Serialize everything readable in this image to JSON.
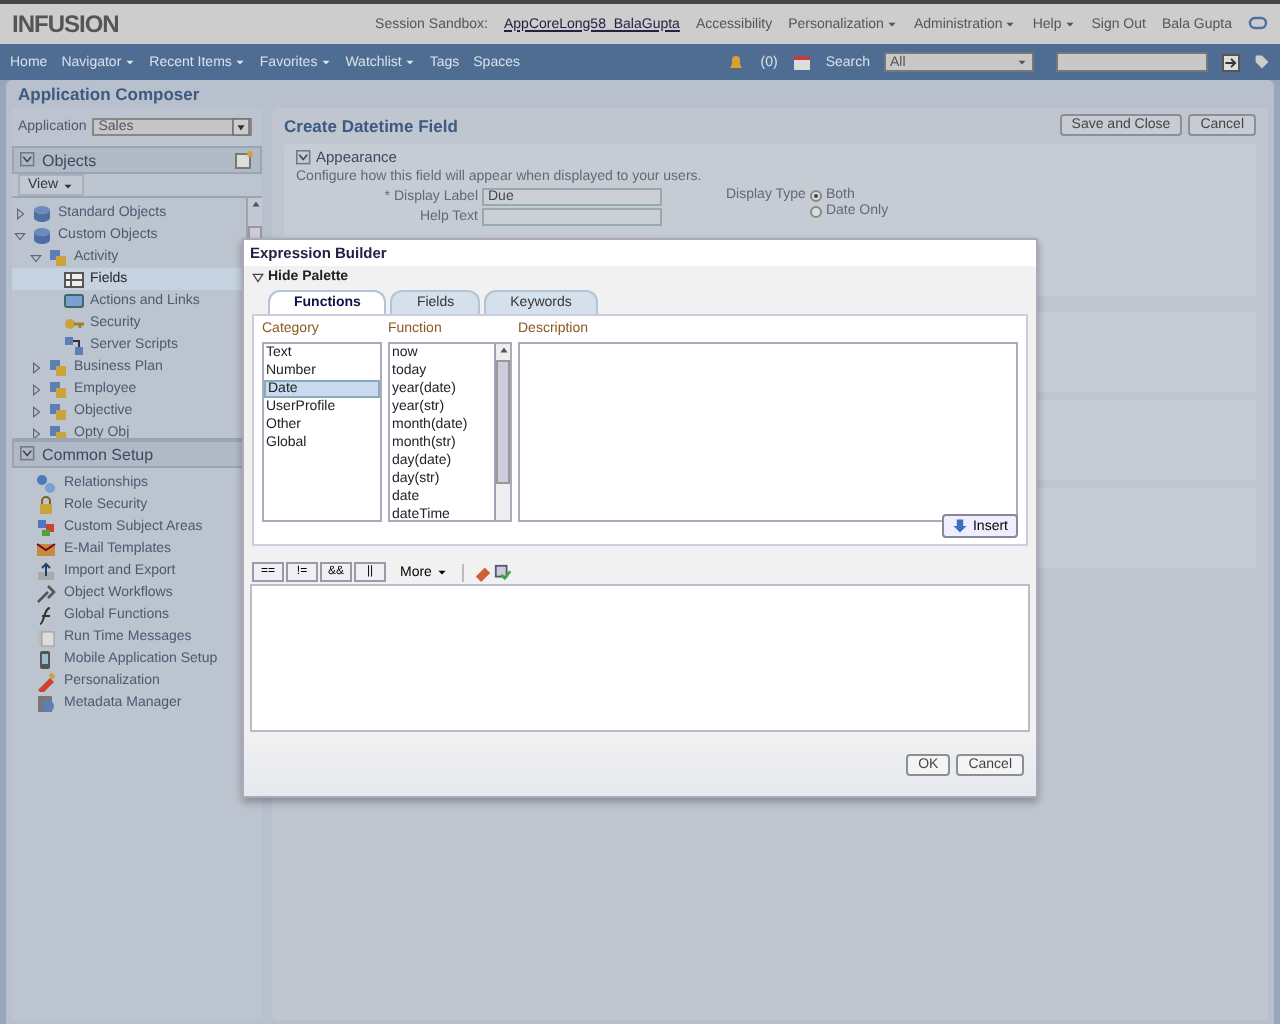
{
  "header": {
    "logo": "INFUSION",
    "session_label": "Session Sandbox:",
    "sandbox": "AppCoreLong58_BalaGupta",
    "links": [
      {
        "label": "Accessibility",
        "menu": false
      },
      {
        "label": "Personalization",
        "menu": true
      },
      {
        "label": "Administration",
        "menu": true
      },
      {
        "label": "Help",
        "menu": true
      },
      {
        "label": "Sign Out",
        "menu": false
      }
    ],
    "user": "Bala Gupta"
  },
  "nav": {
    "items": [
      {
        "label": "Home",
        "menu": false
      },
      {
        "label": "Navigator",
        "menu": true
      },
      {
        "label": "Recent Items",
        "menu": true
      },
      {
        "label": "Favorites",
        "menu": true
      },
      {
        "label": "Watchlist",
        "menu": true
      },
      {
        "label": "Tags",
        "menu": false
      },
      {
        "label": "Spaces",
        "menu": false
      }
    ],
    "notifications": "(0)",
    "search_label": "Search",
    "search_scope": "All"
  },
  "page_title": "Application Composer",
  "sidebar": {
    "application_label": "Application",
    "application": "Sales",
    "objects_title": "Objects",
    "view_menu": "View",
    "tree": [
      {
        "label": "Standard Objects",
        "expanded": false,
        "selected": false
      },
      {
        "label": "Custom Objects",
        "expanded": true,
        "selected": false,
        "children": [
          {
            "label": "Activity",
            "expanded": true,
            "selected": false,
            "children": [
              {
                "label": "Fields",
                "selected": true
              },
              {
                "label": "Actions and Links",
                "selected": false
              },
              {
                "label": "Security",
                "selected": false
              },
              {
                "label": "Server Scripts",
                "selected": false
              }
            ]
          },
          {
            "label": "Business Plan",
            "expanded": false,
            "selected": false
          },
          {
            "label": "Employee",
            "expanded": false,
            "selected": false
          },
          {
            "label": "Objective",
            "expanded": false,
            "selected": false
          },
          {
            "label": "Opty Obj",
            "expanded": false,
            "selected": false
          }
        ]
      }
    ],
    "common_setup_title": "Common Setup",
    "setup_items": [
      "Relationships",
      "Role Security",
      "Custom Subject Areas",
      "E-Mail Templates",
      "Import and Export",
      "Object Workflows",
      "Global Functions",
      "Run Time Messages",
      "Mobile Application Setup",
      "Personalization",
      "Metadata Manager"
    ]
  },
  "content": {
    "title": "Create Datetime Field",
    "buttons": [
      "Save and Close",
      "Cancel"
    ],
    "section": {
      "title": "Appearance",
      "description": "Configure how this field will appear when displayed to your users.",
      "display_label": {
        "required_marker": "*",
        "label": "Display Label",
        "value": "Due"
      },
      "help_text": {
        "label": "Help Text"
      },
      "display_type": {
        "label": "Display Type",
        "options": [
          {
            "label": "Both",
            "selected": true
          },
          {
            "label": "Date Only",
            "selected": false
          }
        ]
      }
    }
  },
  "dialog": {
    "title": "Expression Builder",
    "palette_toggle": "Hide Palette",
    "tabs": [
      {
        "label": "Functions",
        "selected": true
      },
      {
        "label": "Fields",
        "selected": false
      },
      {
        "label": "Keywords",
        "selected": false
      }
    ],
    "columns": [
      "Category",
      "Function",
      "Description"
    ],
    "categories": [
      {
        "label": "Text",
        "selected": false
      },
      {
        "label": "Number",
        "selected": false
      },
      {
        "label": "Date",
        "selected": true
      },
      {
        "label": "UserProfile",
        "selected": false
      },
      {
        "label": "Other",
        "selected": false
      },
      {
        "label": "Global",
        "selected": false
      }
    ],
    "functions": [
      {
        "label": "now",
        "selected": false
      },
      {
        "label": "today",
        "selected": false
      },
      {
        "label": "year(date)",
        "selected": false
      },
      {
        "label": "year(str)",
        "selected": false
      },
      {
        "label": "month(date)",
        "selected": false
      },
      {
        "label": "month(str)",
        "selected": false
      },
      {
        "label": "day(date)",
        "selected": false
      },
      {
        "label": "day(str)",
        "selected": false
      },
      {
        "label": "date",
        "selected": false
      },
      {
        "label": "dateTime",
        "selected": false
      }
    ],
    "insert": "Insert",
    "operators": [
      "==",
      "!=",
      "&&",
      "||"
    ],
    "more": "More",
    "ok": "OK",
    "cancel": "Cancel"
  }
}
